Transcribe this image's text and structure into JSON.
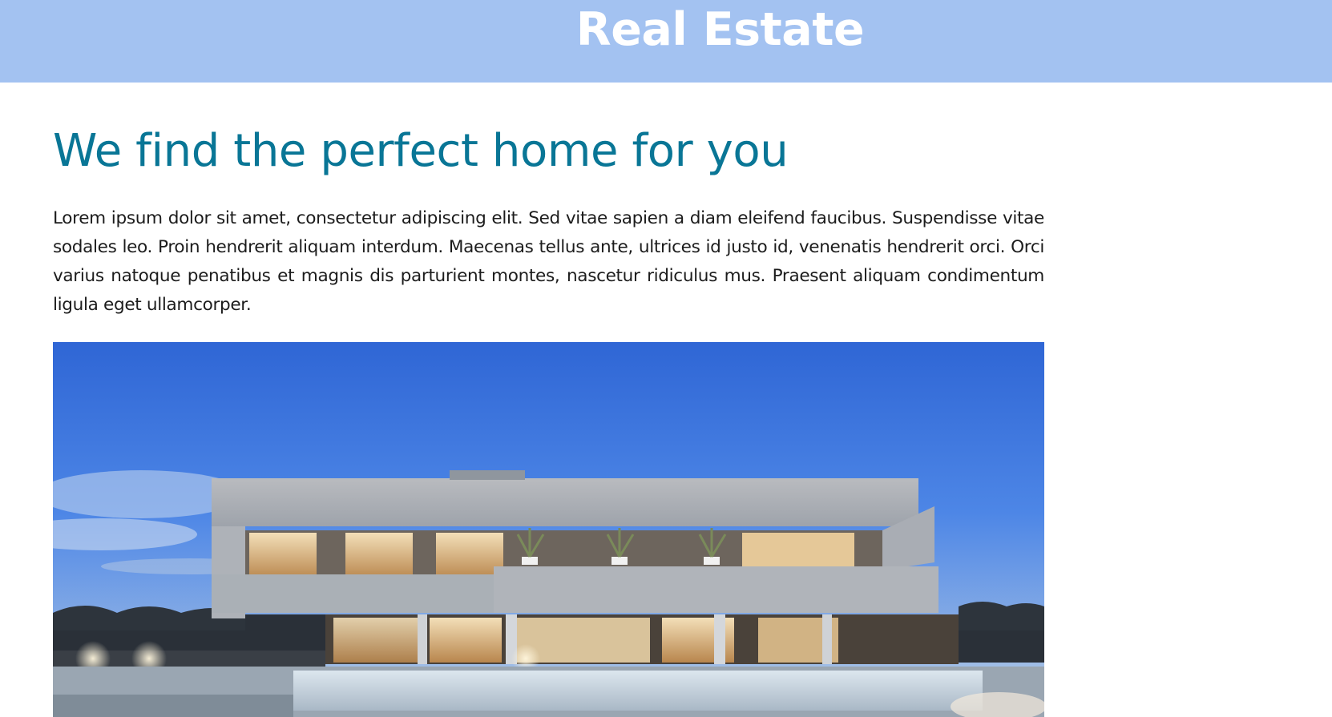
{
  "header": {
    "site_title": "Real Estate",
    "background": "#a3c2f1"
  },
  "main": {
    "heading": "We find the perfect home for you",
    "heading_color": "#097696",
    "intro": "Lorem ipsum dolor sit amet, consectetur adipiscing elit. Sed vitae sapien a diam eleifend faucibus. Suspendisse vitae sodales leo. Proin hendrerit aliquam interdum. Maecenas tellus ante, ultrices id justo id, venenatis hendrerit orci. Orci varius natoque penatibus et magnis dis parturient montes, nascetur ridiculus mus. Praesent aliquam condimentum ligula eget ullamcorper."
  }
}
